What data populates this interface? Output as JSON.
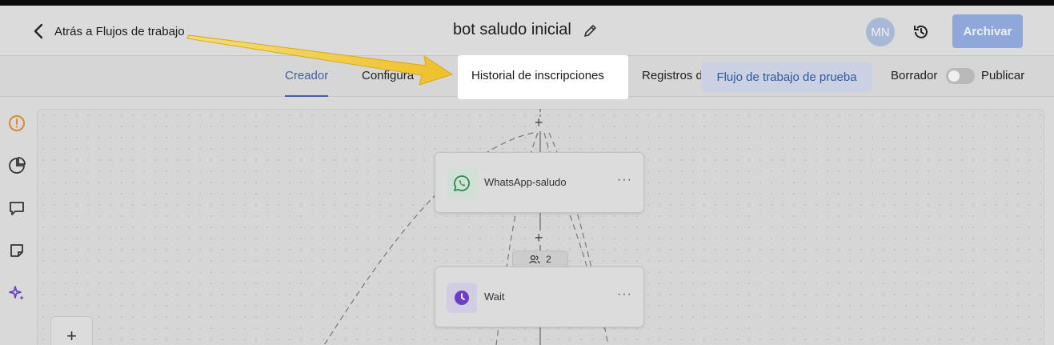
{
  "header": {
    "back_label": "Atrás a Flujos de trabajo",
    "title": "bot saludo inicial",
    "avatar_initials": "MN",
    "archive_label": "Archivar"
  },
  "tabs": {
    "creador": "Creador",
    "configuracion": "Configura",
    "historial": "Historial de inscripciones",
    "registros": "Registros d",
    "test_button": "Flujo de trabajo de prueba",
    "draft_label": "Borrador",
    "publish_label": "Publicar"
  },
  "canvas": {
    "nodes": [
      {
        "label": "WhatsApp-saludo",
        "icon": "whatsapp-icon"
      },
      {
        "label": "Wait",
        "icon": "clock-icon"
      }
    ],
    "contact_count": "2",
    "plus_symbol": "+"
  },
  "colors": {
    "accent": "#3f5fa6",
    "archive_bg": "#8fa8d9",
    "whatsapp": "#2f8a55",
    "wait": "#6b3fc4",
    "alert": "#d98a2b",
    "arrow": "#f2c233"
  }
}
